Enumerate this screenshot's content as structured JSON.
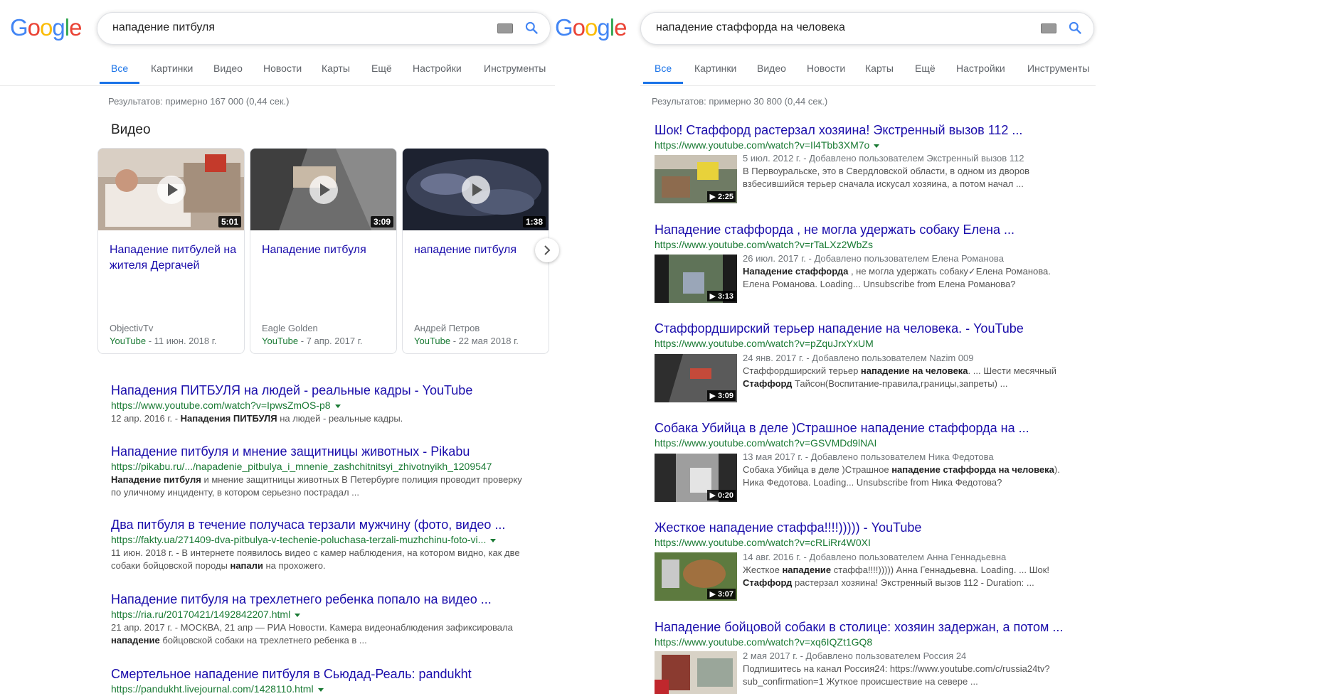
{
  "left": {
    "logo": [
      "G",
      "o",
      "o",
      "g",
      "l",
      "e"
    ],
    "query": "нападение питбуля",
    "tabs": [
      "Все",
      "Картинки",
      "Видео",
      "Новости",
      "Карты",
      "Ещё",
      "Настройки",
      "Инструменты"
    ],
    "stats": "Результатов: примерно 167 000 (0,44 сек.)",
    "video_section_title": "Видео",
    "videos": [
      {
        "title": "Нападение питбулей на жителя Дергачей",
        "duration": "5:01",
        "source": "ObjectivTv",
        "platform": "YouTube",
        "date": " - 11 июн. 2018 г."
      },
      {
        "title": "Нападение питбуля",
        "duration": "3:09",
        "source": "Eagle Golden",
        "platform": "YouTube",
        "date": " - 7 апр. 2017 г."
      },
      {
        "title": "нападение питбуля",
        "duration": "1:38",
        "source": "Андрей Петров",
        "platform": "YouTube",
        "date": " - 22 мая 2018 г."
      }
    ],
    "results": [
      {
        "title": "Нападения ПИТБУЛЯ на людей - реальные кадры - YouTube",
        "url": "https://www.youtube.com/watch?v=IpwsZmOS-p8",
        "snippet_html": "12 апр. 2016 г. - <b>Нападения ПИТБУЛЯ</b> на людей - реальные кадры."
      },
      {
        "title": "Нападение питбуля и мнение защитницы животных - Pikabu",
        "url": "https://pikabu.ru/.../napadenie_pitbulya_i_mnenie_zashchitnitsyi_zhivotnyikh_1209547",
        "snippet_html": "<b>Нападение питбуля</b> и мнение защитницы животных В Петербурге полиция проводит проверку<br>по уличному инциденту, в котором серьезно пострадал ..."
      },
      {
        "title": "Два питбуля в течение получаса терзали мужчину (фото, видео ...",
        "url": "https://fakty.ua/271409-dva-pitbulya-v-techenie-poluchasa-terzali-muzhchinu-foto-vi...",
        "snippet_html": "11 июн. 2018 г. - В интернете появилось видео с камер наблюдения, на котором видно, как две<br>собаки бойцовской породы <b>напали</b> на прохожего."
      },
      {
        "title": "Нападение питбуля на трехлетнего ребенка попало на видео ...",
        "url": "https://ria.ru/20170421/1492842207.html",
        "snippet_html": "21 апр. 2017 г. - МОСКВА, 21 апр — РИА Новости. Камера видеонаблюдения зафиксировала<br><b>нападение</b> бойцовской собаки на трехлетнего ребенка в ..."
      },
      {
        "title": "Смертельное нападение питбуля в Сьюдад-Реаль: pandukht",
        "url": "https://pandukht.livejournal.com/1428110.html",
        "snippet_html": ""
      }
    ]
  },
  "right": {
    "logo": [
      "G",
      "o",
      "o",
      "g",
      "l",
      "e"
    ],
    "query": "нападение стаффорда на человека",
    "tabs": [
      "Все",
      "Картинки",
      "Видео",
      "Новости",
      "Карты",
      "Ещё",
      "Настройки",
      "Инструменты"
    ],
    "stats": "Результатов: примерно 30 800 (0,44 сек.)",
    "results": [
      {
        "title": "Шок! Стаффорд растерзал хозяина! Экстренный вызов 112 ...",
        "url": "https://www.youtube.com/watch?v=Il4Tbb3XM7o",
        "meta": "5 июл. 2012 г. - Добавлено пользователем Экстренный вызов 112",
        "snippet_html": "В Первоуральске, это в Свердловской области, в одном из дворов<br>взбесившийся терьер сначала искусал хозяина, а потом начал ...",
        "duration": "2:25"
      },
      {
        "title": "Нападение стаффорда , не могла удержать собаку Елена ...",
        "url": "https://www.youtube.com/watch?v=rTaLXz2WbZs",
        "meta": "26 июл. 2017 г. - Добавлено пользователем Елена Романова",
        "snippet_html": "<b>Нападение стаффорда</b> , не могла удержать собаку✓Елена Романова.<br>Елена Романова. Loading... Unsubscribe from Елена Романова?",
        "duration": "3:13"
      },
      {
        "title": "Стаффордширский терьер нападение на человека. - YouTube",
        "url": "https://www.youtube.com/watch?v=pZquJrxYxUM",
        "meta": "24 янв. 2017 г. - Добавлено пользователем Nazim 009",
        "snippet_html": "Стаффордширский терьер <b>нападение на человека</b>. ... Шести месячный<br><b>Стаффорд</b> Тайсон(Воспитание-правила,границы,запреты) ...",
        "duration": "3:09"
      },
      {
        "title": "Собака Убийца в деле )Страшное нападение стаффорда на ...",
        "url": "https://www.youtube.com/watch?v=GSVMDd9lNAI",
        "meta": "13 мая 2017 г. - Добавлено пользователем Ника Федотова",
        "snippet_html": "Собака Убийца в деле )Страшное <b>нападение стаффорда на человека</b>).<br>Ника Федотова. Loading... Unsubscribe from Ника Федотова?",
        "duration": "0:20"
      },
      {
        "title": "Жесткое нападение стаффа!!!!))))) - YouTube",
        "url": "https://www.youtube.com/watch?v=cRLiRr4W0XI",
        "meta": "14 авг. 2016 г. - Добавлено пользователем Анна Геннадьевна",
        "snippet_html": "Жесткое <b>нападение</b> стаффа!!!!))))) Анна Геннадьевна. Loading. ... Шок!<br><b>Стаффорд</b> растерзал хозяина! Экстренный вызов 112 - Duration: ...",
        "duration": "3:07"
      },
      {
        "title": "Нападение бойцовой собаки в столице: хозяин задержан, а потом ...",
        "url": "https://www.youtube.com/watch?v=xq6IQZt1GQ8",
        "meta": "2 мая 2017 г. - Добавлено пользователем Россия 24",
        "snippet_html": "Подпишитесь на канал Россия24: https://www.youtube.com/c/russia24tv?<br>sub_confirmation=1 Жуткое происшествие на севере ...",
        "duration": ""
      }
    ]
  },
  "colors": {
    "link": "#1a0dab",
    "url": "#1a7a34",
    "accent": "#1a73e8",
    "g_blue": "#4285f4",
    "g_red": "#ea4335",
    "g_yellow": "#fbbc05",
    "g_green": "#34a853"
  }
}
